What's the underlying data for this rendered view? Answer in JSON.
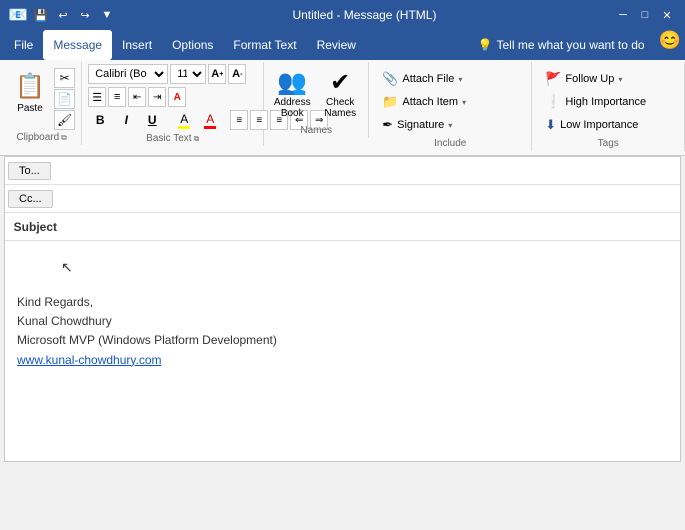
{
  "titlebar": {
    "title": "Untitled - Message (HTML)",
    "qat": [
      "save-icon",
      "undo-icon",
      "redo-icon"
    ],
    "controls": [
      "minimize",
      "maximize",
      "close"
    ]
  },
  "menubar": {
    "items": [
      "File",
      "Message",
      "Insert",
      "Options",
      "Format Text",
      "Review"
    ],
    "active": "Message",
    "tell": "Tell me what you want to do"
  },
  "ribbon": {
    "groups": {
      "clipboard": {
        "label": "Clipboard",
        "paste_label": "Paste"
      },
      "basic_text": {
        "label": "Basic Text",
        "font": "Calibri (Bo",
        "size": "11",
        "bold": "B",
        "italic": "I",
        "underline": "U"
      },
      "names": {
        "label": "Names",
        "address_book": "Address Book",
        "check_names": "Check Names"
      },
      "include": {
        "label": "Include",
        "attach_file": "Attach File",
        "attach_item": "Attach Item",
        "signature": "Signature"
      },
      "tags": {
        "label": "Tags",
        "follow_up": "Follow Up",
        "high_importance": "High Importance",
        "low_importance": "Low Importance"
      }
    }
  },
  "compose": {
    "to_label": "To...",
    "cc_label": "Cc...",
    "subject_label": "Subject",
    "to_placeholder": "",
    "cc_placeholder": "",
    "subject_placeholder": ""
  },
  "body": {
    "line1": "Kind Regards,",
    "line2": "Kunal Chowdhury",
    "line3": "Microsoft MVP (Windows Platform Development)",
    "link": "www.kunal-chowdhury.com"
  }
}
